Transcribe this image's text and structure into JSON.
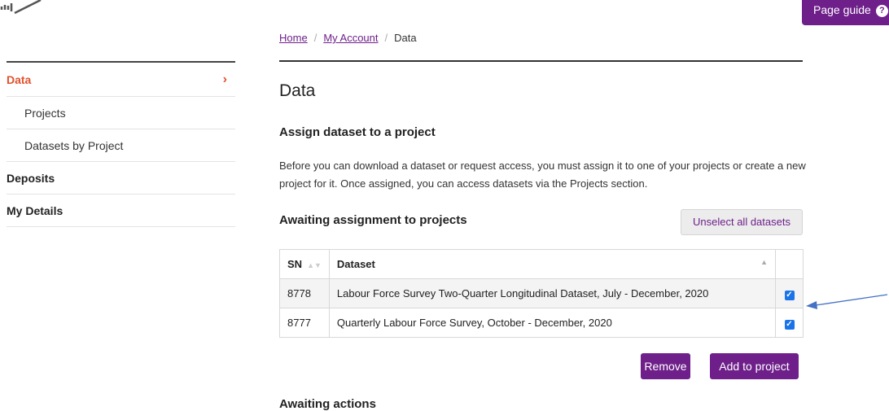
{
  "header": {
    "page_guide_label": "Page guide",
    "page_guide_icon": "?"
  },
  "sidebar": {
    "items": [
      {
        "label": "Data",
        "level": 1,
        "active": true
      },
      {
        "label": "Projects",
        "level": 2
      },
      {
        "label": "Datasets by Project",
        "level": 2
      },
      {
        "label": "Deposits",
        "level": 1
      },
      {
        "label": "My Details",
        "level": 1
      }
    ],
    "active_chevron": "›"
  },
  "breadcrumb": {
    "home": "Home",
    "account": "My Account",
    "current": "Data",
    "separator": "/"
  },
  "main": {
    "title": "Data",
    "assign_heading": "Assign dataset to a project",
    "intro": "Before you can download a dataset or request access, you must assign it to one of your projects or create a new project for it. Once assigned, you can access datasets via the Projects section.",
    "awaiting_assignment_heading": "Awaiting assignment to projects",
    "unselect_all_label": "Unselect all datasets",
    "table": {
      "headers": {
        "sn": "SN",
        "dataset": "Dataset"
      },
      "rows": [
        {
          "sn": "8778",
          "dataset": "Labour Force Survey Two-Quarter Longitudinal Dataset, July - December, 2020",
          "checked": true
        },
        {
          "sn": "8777",
          "dataset": "Quarterly Labour Force Survey, October - December, 2020",
          "checked": true
        }
      ]
    },
    "remove_label": "Remove",
    "add_to_project_label": "Add to project",
    "awaiting_actions_heading": "Awaiting actions"
  },
  "colors": {
    "brand_purple": "#6e1f8a",
    "accent_orange": "#e0532f",
    "checkbox_blue": "#1a73e8",
    "arrow_blue": "#4472c4"
  }
}
